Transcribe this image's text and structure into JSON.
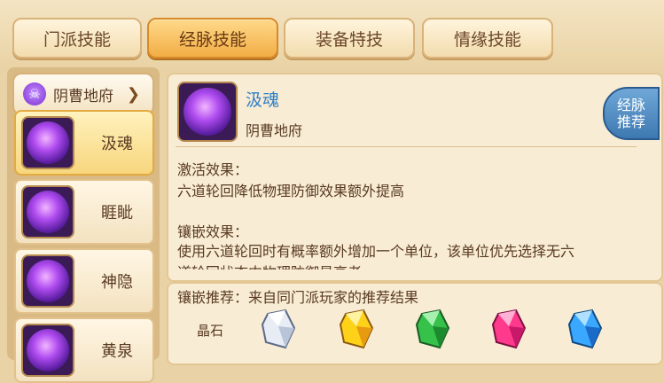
{
  "tabs": [
    {
      "label": "门派技能",
      "active": false
    },
    {
      "label": "经脉技能",
      "active": true
    },
    {
      "label": "装备特技",
      "active": false
    },
    {
      "label": "情缘技能",
      "active": false
    }
  ],
  "school_selector": {
    "label": "阴曹地府"
  },
  "skills": [
    {
      "name": "汲魂",
      "selected": true
    },
    {
      "name": "睚眦",
      "selected": false
    },
    {
      "name": "神隐",
      "selected": false
    },
    {
      "name": "黄泉",
      "selected": false
    }
  ],
  "detail": {
    "name": "汲魂",
    "school": "阴曹地府",
    "activate_title": "激活效果：",
    "activate_text": "六道轮回降低物理防御效果额外提高",
    "inlay_title": "镶嵌效果：",
    "inlay_line1": "使用六道轮回时有概率额外增加一个单位，该单位优先选择无六",
    "inlay_line2": "道轮回状态中物理防御最高者",
    "recommend_button": [
      "经脉",
      "推荐"
    ]
  },
  "recommend": {
    "title": "镶嵌推荐：来自同门派玩家的推荐结果",
    "gem_label": "晶石",
    "gems": [
      {
        "icon": "white-crystal-icon",
        "color": "#e8ecf4"
      },
      {
        "icon": "yellow-crystal-icon",
        "color": "#ffd21a"
      },
      {
        "icon": "green-crystal-icon",
        "color": "#36c24a"
      },
      {
        "icon": "pink-crystal-icon",
        "color": "#ff3a8c"
      },
      {
        "icon": "blue-crystal-icon",
        "color": "#3aa8ff"
      }
    ]
  },
  "colors": {
    "active_tab": "#f2ad45",
    "skill_name": "#2e7fc8",
    "recommend_button": "#3d78b0"
  }
}
